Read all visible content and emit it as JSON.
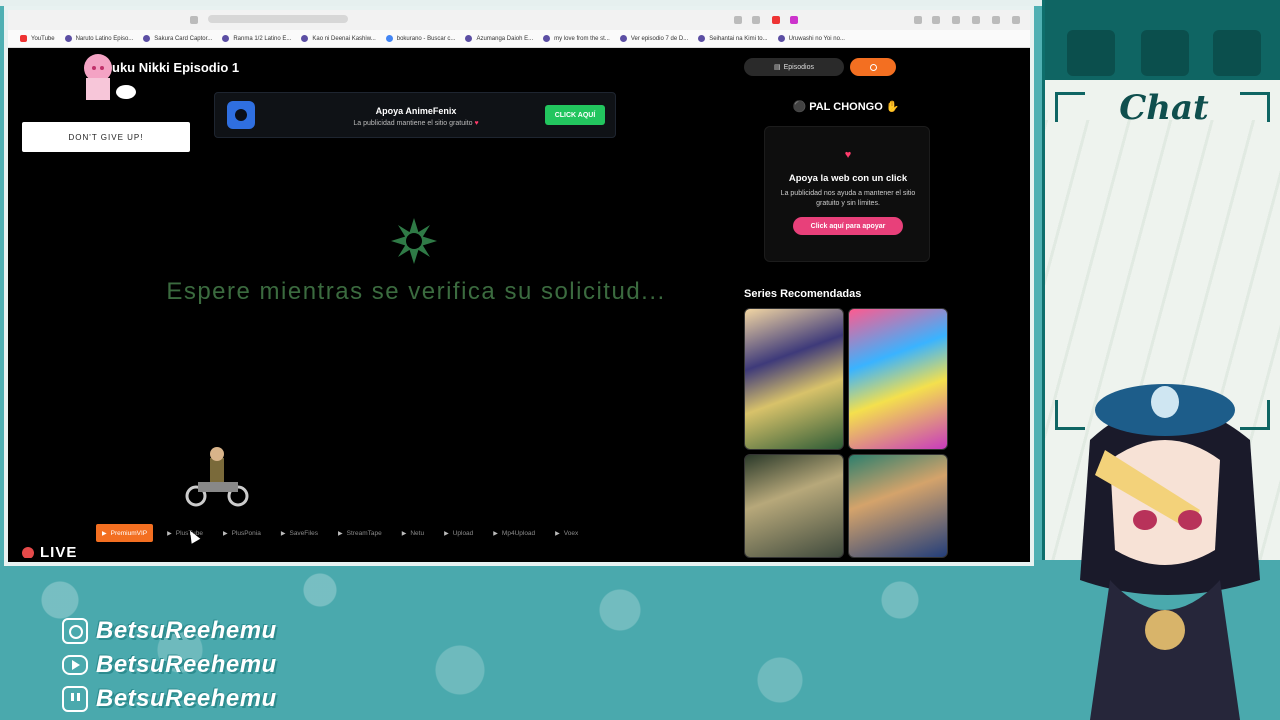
{
  "bookmarks": [
    {
      "label": "YouTube",
      "icon": "youtube-icon"
    },
    {
      "label": "Naruto Latino Episo...",
      "icon": "site-icon"
    },
    {
      "label": "Sakura Card Captor...",
      "icon": "site-icon"
    },
    {
      "label": "Ranma 1/2 Latino E...",
      "icon": "site-icon"
    },
    {
      "label": "Kao ni Deenai Kashiw...",
      "icon": "site-icon"
    },
    {
      "label": "bokurano - Buscar c...",
      "icon": "google-icon"
    },
    {
      "label": "Azumanga Daioh E...",
      "icon": "site-icon"
    },
    {
      "label": "my love from the st...",
      "icon": "site-icon"
    },
    {
      "label": "Ver episodio 7 de D...",
      "icon": "site-icon"
    },
    {
      "label": "Seihantai na Kimi to...",
      "icon": "site-icon"
    },
    {
      "label": "Uruwashi no Yoi no...",
      "icon": "site-icon"
    }
  ],
  "page": {
    "episode_title": "uku Nikki Episodio 1",
    "dgu_text": "DON'T GIVE UP!",
    "support_banner": {
      "title": "Apoya AnimeFenix",
      "subtitle": "La publicidad mantiene el sitio gratuito",
      "heart": "♥",
      "cta": "CLICK AQUÍ"
    },
    "wait_message": "Espere mientras se verifica su solicitud...",
    "servers": [
      "PremiumVIP",
      "PlusTube",
      "PlusPonia",
      "SaveFiles",
      "StreamTape",
      "Netu",
      "Upload",
      "Mp4Upload",
      "Voex"
    ],
    "active_server": "PremiumVIP",
    "live_label": "LIVE"
  },
  "sidebar": {
    "episodes_button": "Episodios",
    "chongo_title": "PAL CHONGO",
    "support_card": {
      "heart": "♥",
      "heading": "Apoya la web con un click",
      "text": "La publicidad nos ayuda a mantener el sitio gratuito y sin límites.",
      "cta": "Click aquí para apoyar"
    },
    "series_title": "Series Recomendadas"
  },
  "chat": {
    "title": "Chat"
  },
  "socials": [
    {
      "icon": "instagram-icon",
      "handle": "BetsuReehemu"
    },
    {
      "icon": "youtube-icon",
      "handle": "BetsuReehemu"
    },
    {
      "icon": "twitch-icon",
      "handle": "BetsuReehemu"
    }
  ],
  "colors": {
    "accent_orange": "#f36f21",
    "cta_green": "#22c55e",
    "cta_pink": "#e8407a",
    "overlay_teal": "#4fb0b3",
    "wait_text": "#3b6b3f"
  }
}
